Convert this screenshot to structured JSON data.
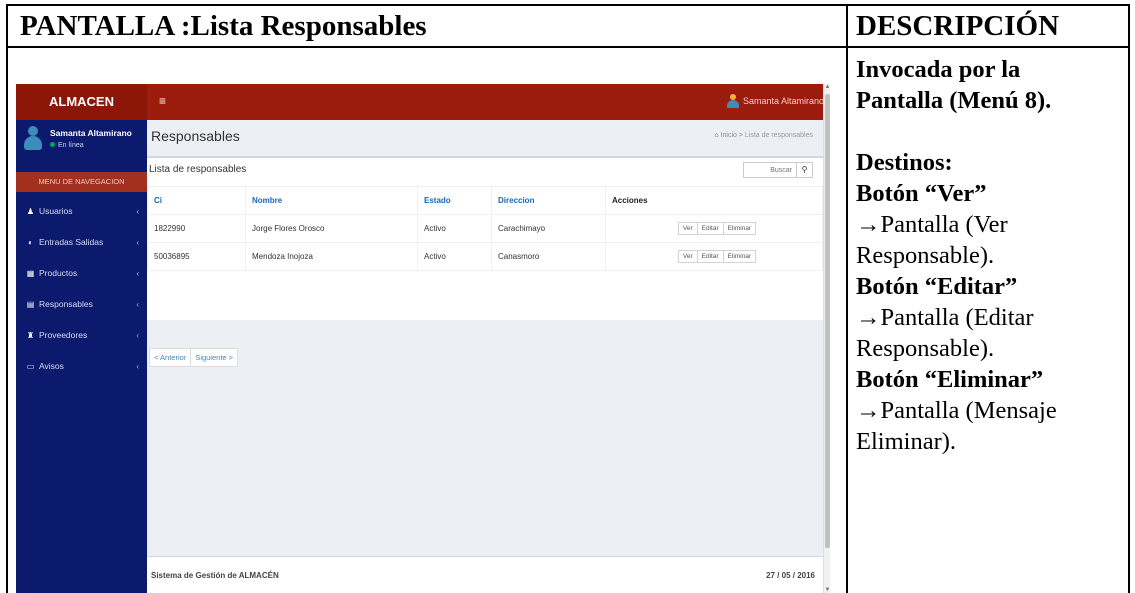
{
  "doc": {
    "title_left": "PANTALLA :Lista Responsables",
    "title_right": "DESCRIPCIÓN",
    "invoked_line1": "Invocada por la",
    "invoked_line2": "Pantalla (Menú 8).",
    "destinos": "Destinos:",
    "btn_ver": "Botón “Ver”",
    "ver_dest1": "→Pantalla (Ver",
    "ver_dest2": "Responsable).",
    "btn_editar": "Botón “Editar”",
    "editar_dest1": "→Pantalla (Editar",
    "editar_dest2": "Responsable).",
    "btn_eliminar": "Botón “Eliminar”",
    "eliminar_dest1": "→Pantalla (Mensaje",
    "eliminar_dest2": "Eliminar)."
  },
  "app": {
    "logo": "ALMACEN",
    "hamburger": "≡",
    "top_user": "Samanta Altamirano",
    "sidebar": {
      "user_name": "Samanta Altamirano",
      "status": "En línea",
      "nav_header": "MENU DE NAVEGACION",
      "items": [
        {
          "icon": "♟",
          "label": "Usuarios"
        },
        {
          "icon": "◐",
          "label": "Entradas Salidas"
        },
        {
          "icon": "▦",
          "label": "Productos"
        },
        {
          "icon": "▤",
          "label": "Responsables"
        },
        {
          "icon": "♜",
          "label": "Proveedores"
        },
        {
          "icon": "▭",
          "label": "Avisos"
        }
      ],
      "chevron": "‹"
    },
    "page_title": "Responsables",
    "breadcrumb": {
      "home": "Inicio",
      "sep": ">",
      "current": "Lista de responsables"
    },
    "box_title": "Lista de responsables",
    "search_placeholder": "Buscar",
    "search_icon": "⚲",
    "table": {
      "headers": [
        "Ci",
        "Nombre",
        "Estado",
        "Direccion",
        "Acciones"
      ],
      "rows": [
        {
          "ci": "1822990",
          "nombre": "Jorge Flores Orosco",
          "estado": "Activo",
          "direccion": "Carachimayo"
        },
        {
          "ci": "50036895",
          "nombre": "Mendoza Inojoza",
          "estado": "Activo",
          "direccion": "Canasmoro"
        }
      ],
      "actions": {
        "ver": "Ver",
        "editar": "Editar",
        "eliminar": "Eliminar"
      }
    },
    "pager": {
      "prev": "< Anterior",
      "next": "Siguiente >"
    },
    "footer": {
      "left": "Sistema de Gestión de ALMACÉN",
      "right": "27 / 05 / 2016"
    }
  }
}
